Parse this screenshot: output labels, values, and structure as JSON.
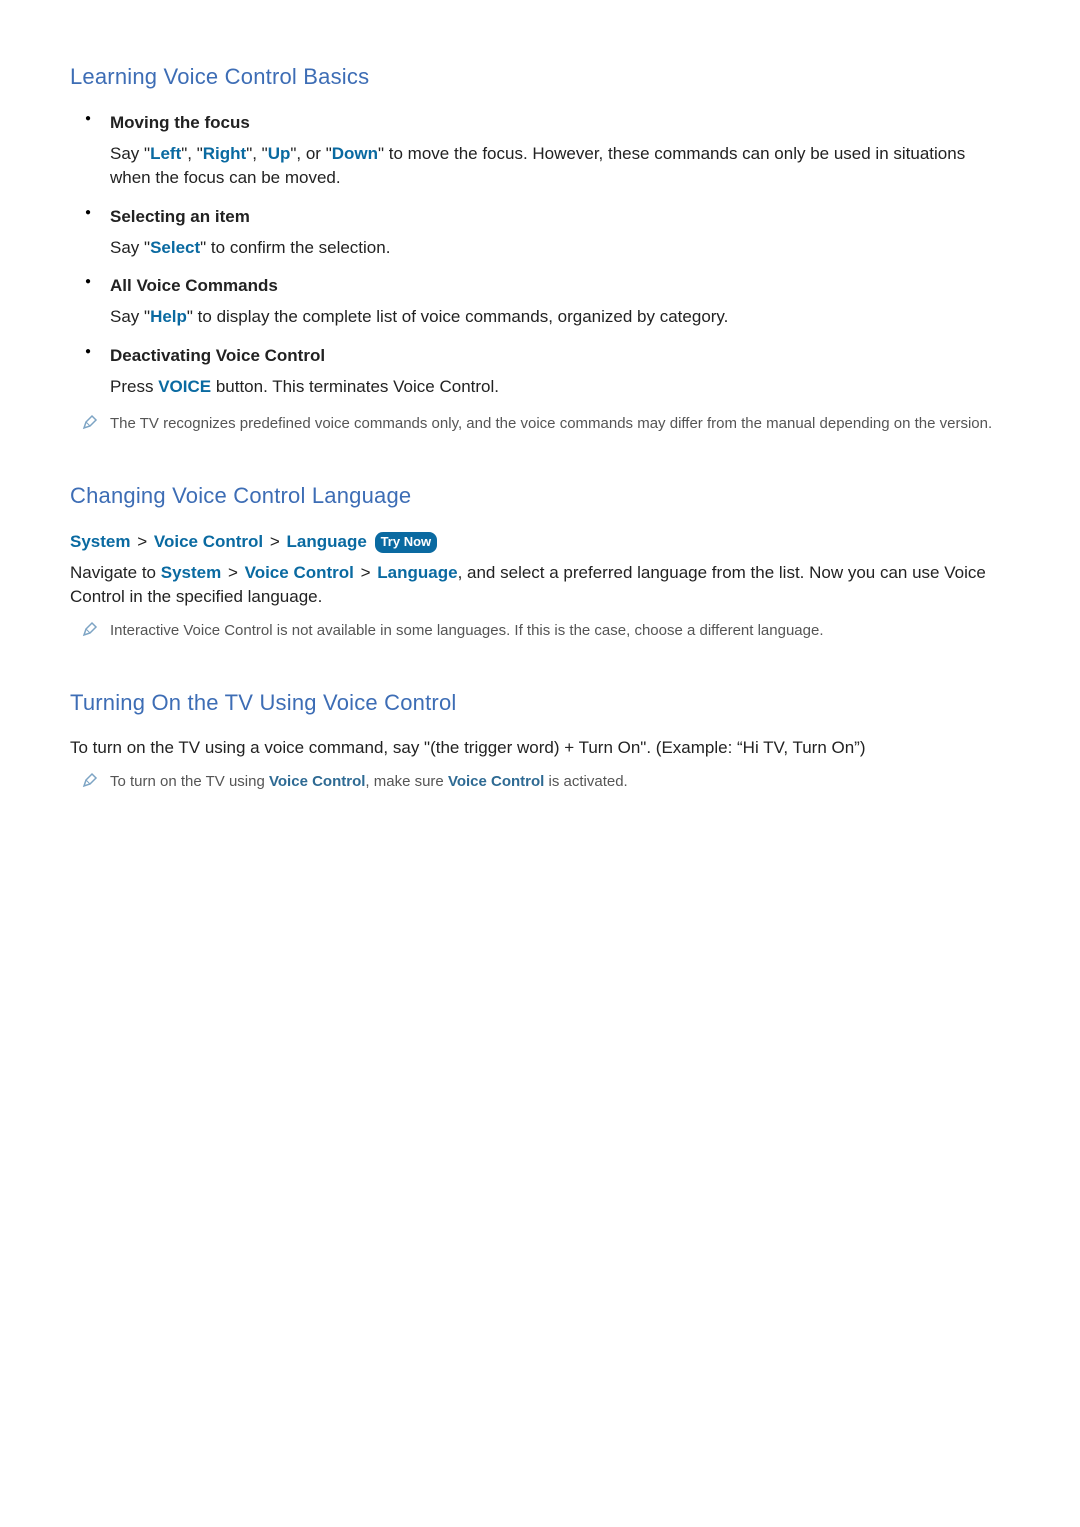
{
  "section1": {
    "heading": "Learning Voice Control Basics",
    "items": [
      {
        "title": "Moving the focus",
        "pre": "Say \"",
        "cmd1": "Left",
        "sep1": "\", \"",
        "cmd2": "Right",
        "sep2": "\", \"",
        "cmd3": "Up",
        "sep3": "\", or \"",
        "cmd4": "Down",
        "post": "\" to move the focus. However, these commands can only be used in situations when the focus can be moved."
      },
      {
        "title": "Selecting an item",
        "pre": "Say \"",
        "cmd1": "Select",
        "post": "\" to confirm the selection."
      },
      {
        "title": "All Voice Commands",
        "pre": "Say \"",
        "cmd1": "Help",
        "post": "\" to display the complete list of voice commands, organized by category."
      },
      {
        "title": "Deactivating Voice Control",
        "pre": "Press ",
        "cmd1": "VOICE",
        "post": " button. This terminates Voice Control."
      }
    ],
    "note": "The TV recognizes predefined voice commands only, and the voice commands may differ from the manual depending on the version."
  },
  "section2": {
    "heading": "Changing Voice Control Language",
    "navpath": {
      "p1": "System",
      "p2": "Voice Control",
      "p3": "Language",
      "trynow": "Try Now"
    },
    "para_pre": "Navigate to ",
    "para_p1": "System",
    "para_p2": "Voice Control",
    "para_p3": "Language",
    "para_post": ", and select a preferred language from the list. Now you can use Voice Control in the specified language.",
    "note": "Interactive Voice Control is not available in some languages. If this is the case, choose a different language."
  },
  "section3": {
    "heading": "Turning On the TV Using Voice Control",
    "para": "To turn on the TV using a voice command, say \"(the trigger word) + Turn On\". (Example: “Hi TV, Turn On”)",
    "note_pre": "To turn on the TV using ",
    "note_cmd1": "Voice Control",
    "note_mid": ", make sure ",
    "note_cmd2": "Voice Control",
    "note_post": " is activated."
  },
  "caret": ">"
}
